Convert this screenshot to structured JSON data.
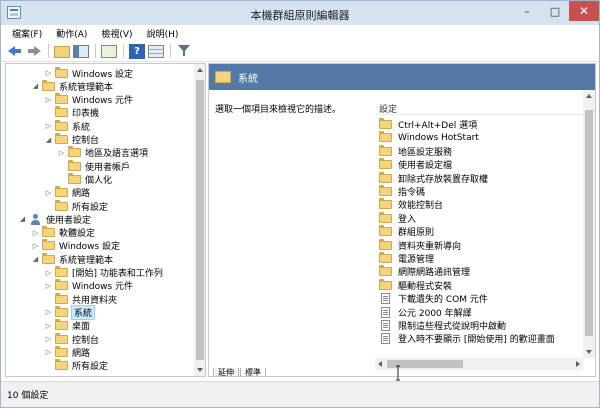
{
  "window": {
    "title": "本機群組原則編輯器",
    "controls": {
      "minimize": "–",
      "maximize": "□",
      "close": "✕"
    }
  },
  "menu": [
    "檔案(F)",
    "動作(A)",
    "檢視(V)",
    "說明(H)"
  ],
  "toolbar": {
    "icons": [
      "back-arrow-icon",
      "forward-arrow-icon",
      "folder-up-icon",
      "show-pane-icon",
      "export-list-icon",
      "help-icon",
      "properties-icon",
      "filter-icon"
    ],
    "help_glyph": "?"
  },
  "tree": {
    "items": [
      {
        "label": "Windows 設定",
        "indent": 2,
        "expander": "▷",
        "icon": "folder"
      },
      {
        "label": "系統管理範本",
        "indent": 1,
        "expander": "◢",
        "icon": "folder"
      },
      {
        "label": "Windows 元件",
        "indent": 2,
        "expander": "▷",
        "icon": "folder"
      },
      {
        "label": "印表機",
        "indent": 2,
        "expander": "",
        "icon": "folder"
      },
      {
        "label": "系統",
        "indent": 2,
        "expander": "▷",
        "icon": "folder"
      },
      {
        "label": "控制台",
        "indent": 2,
        "expander": "◢",
        "icon": "folder"
      },
      {
        "label": "地區及語言選項",
        "indent": 3,
        "expander": "▷",
        "icon": "folder"
      },
      {
        "label": "使用者帳戶",
        "indent": 3,
        "expander": "",
        "icon": "folder"
      },
      {
        "label": "個人化",
        "indent": 3,
        "expander": "",
        "icon": "folder"
      },
      {
        "label": "網路",
        "indent": 2,
        "expander": "▷",
        "icon": "folder"
      },
      {
        "label": "所有設定",
        "indent": 2,
        "expander": "",
        "icon": "folder"
      },
      {
        "label": "使用者設定",
        "indent": 0,
        "expander": "◢",
        "icon": "user"
      },
      {
        "label": "軟體設定",
        "indent": 1,
        "expander": "▷",
        "icon": "folder"
      },
      {
        "label": "Windows 設定",
        "indent": 1,
        "expander": "▷",
        "icon": "folder"
      },
      {
        "label": "系統管理範本",
        "indent": 1,
        "expander": "◢",
        "icon": "folder"
      },
      {
        "label": "[開始] 功能表和工作列",
        "indent": 2,
        "expander": "▷",
        "icon": "folder"
      },
      {
        "label": "Windows 元件",
        "indent": 2,
        "expander": "▷",
        "icon": "folder"
      },
      {
        "label": "共用資料夾",
        "indent": 2,
        "expander": "",
        "icon": "folder"
      },
      {
        "label": "系統",
        "indent": 2,
        "expander": "▷",
        "icon": "folder",
        "selected": true
      },
      {
        "label": "桌面",
        "indent": 2,
        "expander": "▷",
        "icon": "folder"
      },
      {
        "label": "控制台",
        "indent": 2,
        "expander": "▷",
        "icon": "folder"
      },
      {
        "label": "網路",
        "indent": 2,
        "expander": "▷",
        "icon": "folder"
      },
      {
        "label": "所有設定",
        "indent": 2,
        "expander": "",
        "icon": "folder"
      }
    ]
  },
  "right_pane": {
    "header": "系統",
    "description": "選取一個項目來檢視它的描述。",
    "column_header": "設定",
    "items": [
      {
        "label": "Ctrl+Alt+Del 選項",
        "icon": "folder"
      },
      {
        "label": "Windows HotStart",
        "icon": "folder"
      },
      {
        "label": "地區設定服務",
        "icon": "folder"
      },
      {
        "label": "使用者設定檔",
        "icon": "folder"
      },
      {
        "label": "卸除式存放裝置存取權",
        "icon": "folder"
      },
      {
        "label": "指令碼",
        "icon": "folder"
      },
      {
        "label": "效能控制台",
        "icon": "folder"
      },
      {
        "label": "登入",
        "icon": "folder"
      },
      {
        "label": "群組原則",
        "icon": "folder"
      },
      {
        "label": "資料夾重新導向",
        "icon": "folder"
      },
      {
        "label": "電源管理",
        "icon": "folder"
      },
      {
        "label": "網際網路通訊管理",
        "icon": "folder"
      },
      {
        "label": "驅動程式安裝",
        "icon": "folder"
      },
      {
        "label": "下載遺失的 COM 元件",
        "icon": "policy"
      },
      {
        "label": "公元 2000 年解譯",
        "icon": "policy"
      },
      {
        "label": "限制這些程式從說明中啟動",
        "icon": "policy"
      },
      {
        "label": "登入時不要顯示 [開始使用] 的歡迎畫面",
        "icon": "policy"
      }
    ],
    "tabs": [
      "延伸",
      "標準"
    ]
  },
  "statusbar": {
    "text": "10 個設定"
  }
}
